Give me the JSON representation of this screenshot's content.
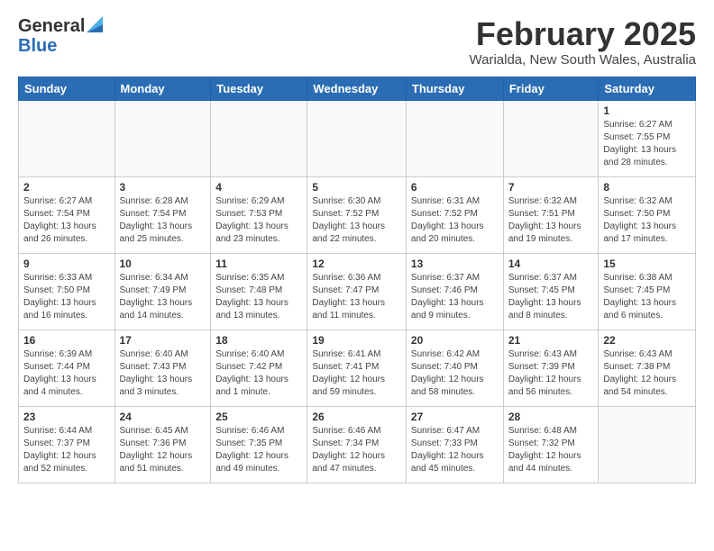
{
  "header": {
    "logo_general": "General",
    "logo_blue": "Blue",
    "month_title": "February 2025",
    "location": "Warialda, New South Wales, Australia"
  },
  "days_of_week": [
    "Sunday",
    "Monday",
    "Tuesday",
    "Wednesday",
    "Thursday",
    "Friday",
    "Saturday"
  ],
  "weeks": [
    [
      {
        "day": "",
        "info": ""
      },
      {
        "day": "",
        "info": ""
      },
      {
        "day": "",
        "info": ""
      },
      {
        "day": "",
        "info": ""
      },
      {
        "day": "",
        "info": ""
      },
      {
        "day": "",
        "info": ""
      },
      {
        "day": "1",
        "info": "Sunrise: 6:27 AM\nSunset: 7:55 PM\nDaylight: 13 hours and 28 minutes."
      }
    ],
    [
      {
        "day": "2",
        "info": "Sunrise: 6:27 AM\nSunset: 7:54 PM\nDaylight: 13 hours and 26 minutes."
      },
      {
        "day": "3",
        "info": "Sunrise: 6:28 AM\nSunset: 7:54 PM\nDaylight: 13 hours and 25 minutes."
      },
      {
        "day": "4",
        "info": "Sunrise: 6:29 AM\nSunset: 7:53 PM\nDaylight: 13 hours and 23 minutes."
      },
      {
        "day": "5",
        "info": "Sunrise: 6:30 AM\nSunset: 7:52 PM\nDaylight: 13 hours and 22 minutes."
      },
      {
        "day": "6",
        "info": "Sunrise: 6:31 AM\nSunset: 7:52 PM\nDaylight: 13 hours and 20 minutes."
      },
      {
        "day": "7",
        "info": "Sunrise: 6:32 AM\nSunset: 7:51 PM\nDaylight: 13 hours and 19 minutes."
      },
      {
        "day": "8",
        "info": "Sunrise: 6:32 AM\nSunset: 7:50 PM\nDaylight: 13 hours and 17 minutes."
      }
    ],
    [
      {
        "day": "9",
        "info": "Sunrise: 6:33 AM\nSunset: 7:50 PM\nDaylight: 13 hours and 16 minutes."
      },
      {
        "day": "10",
        "info": "Sunrise: 6:34 AM\nSunset: 7:49 PM\nDaylight: 13 hours and 14 minutes."
      },
      {
        "day": "11",
        "info": "Sunrise: 6:35 AM\nSunset: 7:48 PM\nDaylight: 13 hours and 13 minutes."
      },
      {
        "day": "12",
        "info": "Sunrise: 6:36 AM\nSunset: 7:47 PM\nDaylight: 13 hours and 11 minutes."
      },
      {
        "day": "13",
        "info": "Sunrise: 6:37 AM\nSunset: 7:46 PM\nDaylight: 13 hours and 9 minutes."
      },
      {
        "day": "14",
        "info": "Sunrise: 6:37 AM\nSunset: 7:45 PM\nDaylight: 13 hours and 8 minutes."
      },
      {
        "day": "15",
        "info": "Sunrise: 6:38 AM\nSunset: 7:45 PM\nDaylight: 13 hours and 6 minutes."
      }
    ],
    [
      {
        "day": "16",
        "info": "Sunrise: 6:39 AM\nSunset: 7:44 PM\nDaylight: 13 hours and 4 minutes."
      },
      {
        "day": "17",
        "info": "Sunrise: 6:40 AM\nSunset: 7:43 PM\nDaylight: 13 hours and 3 minutes."
      },
      {
        "day": "18",
        "info": "Sunrise: 6:40 AM\nSunset: 7:42 PM\nDaylight: 13 hours and 1 minute."
      },
      {
        "day": "19",
        "info": "Sunrise: 6:41 AM\nSunset: 7:41 PM\nDaylight: 12 hours and 59 minutes."
      },
      {
        "day": "20",
        "info": "Sunrise: 6:42 AM\nSunset: 7:40 PM\nDaylight: 12 hours and 58 minutes."
      },
      {
        "day": "21",
        "info": "Sunrise: 6:43 AM\nSunset: 7:39 PM\nDaylight: 12 hours and 56 minutes."
      },
      {
        "day": "22",
        "info": "Sunrise: 6:43 AM\nSunset: 7:38 PM\nDaylight: 12 hours and 54 minutes."
      }
    ],
    [
      {
        "day": "23",
        "info": "Sunrise: 6:44 AM\nSunset: 7:37 PM\nDaylight: 12 hours and 52 minutes."
      },
      {
        "day": "24",
        "info": "Sunrise: 6:45 AM\nSunset: 7:36 PM\nDaylight: 12 hours and 51 minutes."
      },
      {
        "day": "25",
        "info": "Sunrise: 6:46 AM\nSunset: 7:35 PM\nDaylight: 12 hours and 49 minutes."
      },
      {
        "day": "26",
        "info": "Sunrise: 6:46 AM\nSunset: 7:34 PM\nDaylight: 12 hours and 47 minutes."
      },
      {
        "day": "27",
        "info": "Sunrise: 6:47 AM\nSunset: 7:33 PM\nDaylight: 12 hours and 45 minutes."
      },
      {
        "day": "28",
        "info": "Sunrise: 6:48 AM\nSunset: 7:32 PM\nDaylight: 12 hours and 44 minutes."
      },
      {
        "day": "",
        "info": ""
      }
    ]
  ]
}
